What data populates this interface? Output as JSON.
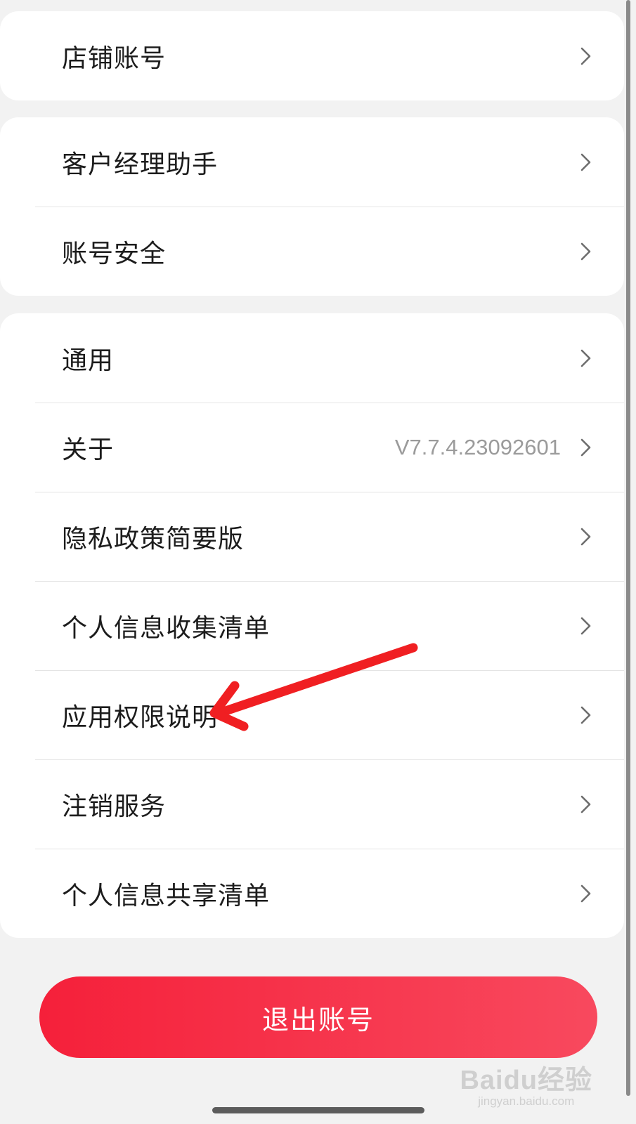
{
  "groups": [
    {
      "items": [
        {
          "label": "店铺账号"
        }
      ]
    },
    {
      "items": [
        {
          "label": "客户经理助手"
        },
        {
          "label": "账号安全"
        }
      ]
    },
    {
      "items": [
        {
          "label": "通用"
        },
        {
          "label": "关于",
          "value": "V7.7.4.23092601"
        },
        {
          "label": "隐私政策简要版"
        },
        {
          "label": "个人信息收集清单"
        },
        {
          "label": "应用权限说明"
        },
        {
          "label": "注销服务"
        },
        {
          "label": "个人信息共享清单"
        }
      ]
    }
  ],
  "logout_label": "退出账号",
  "watermark": {
    "logo": "Baidu经验",
    "url": "jingyan.baidu.com"
  },
  "colors": {
    "accent": "#f5203a",
    "annotation_arrow": "#f01f22",
    "background": "#f2f2f2",
    "card": "#ffffff"
  },
  "icons": {
    "row_indicator": "chevron-right-icon",
    "annotation": "red-arrow-annotation"
  }
}
